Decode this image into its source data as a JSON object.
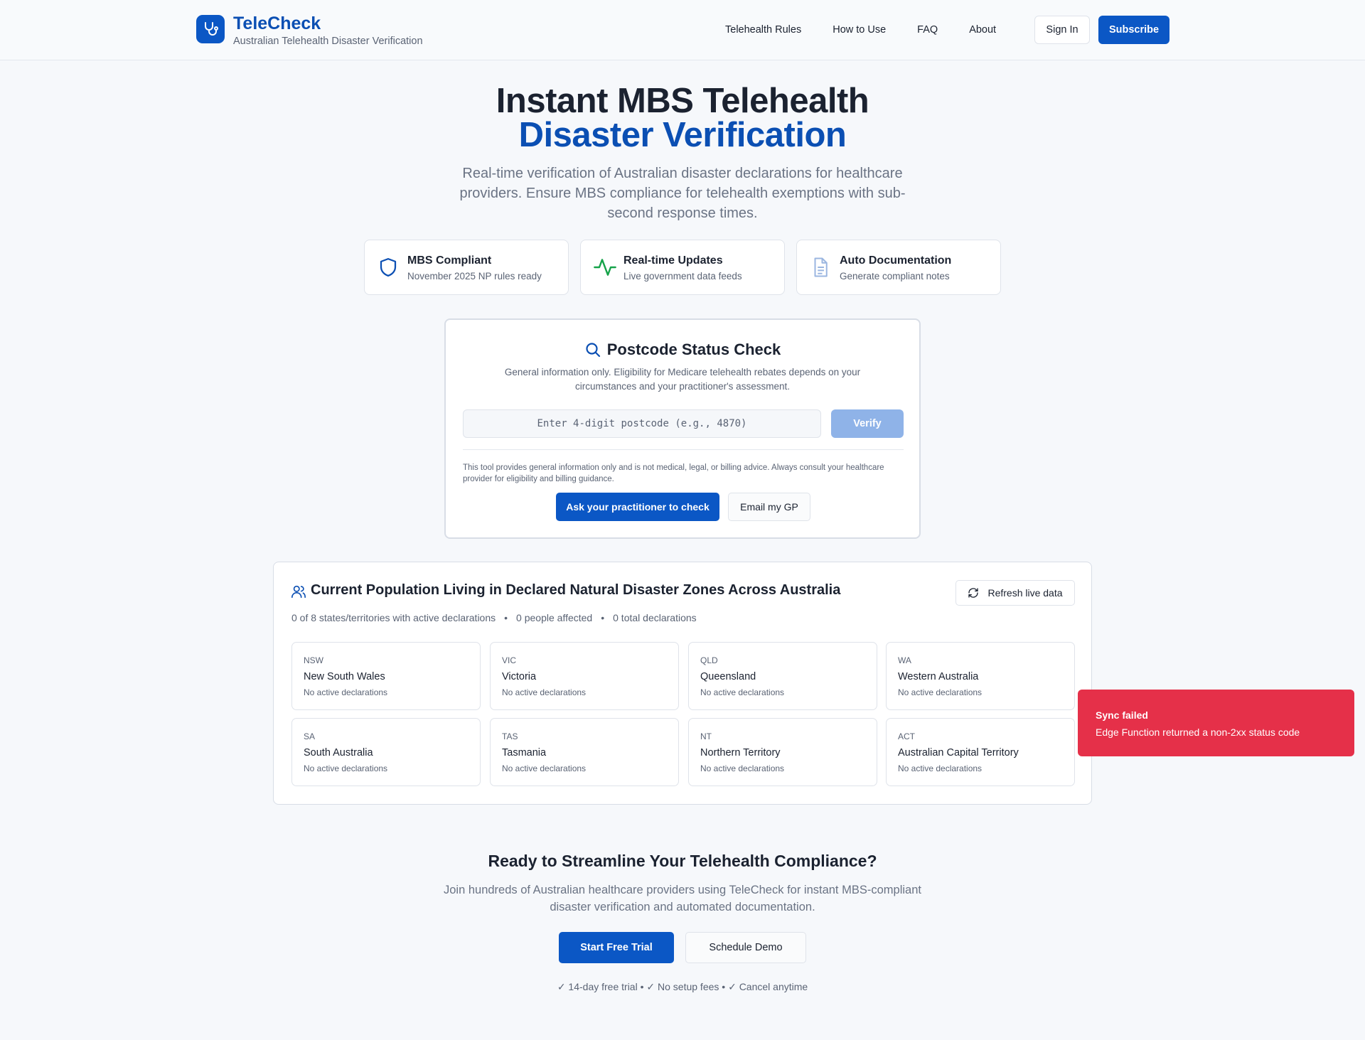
{
  "header": {
    "brand_name": "TeleCheck",
    "brand_tagline": "Australian Telehealth Disaster Verification",
    "nav": [
      "Telehealth Rules",
      "How to Use",
      "FAQ",
      "About"
    ],
    "sign_in": "Sign In",
    "subscribe": "Subscribe"
  },
  "hero": {
    "title_line1": "Instant MBS Telehealth",
    "title_line2": "Disaster Verification",
    "subtitle": "Real-time verification of Australian disaster declarations for healthcare providers. Ensure MBS compliance for telehealth exemptions with sub-second response times."
  },
  "features": [
    {
      "icon": "shield-icon",
      "title": "MBS Compliant",
      "subtitle": "November 2025 NP rules ready"
    },
    {
      "icon": "activity-icon",
      "title": "Real-time Updates",
      "subtitle": "Live government data feeds"
    },
    {
      "icon": "document-icon",
      "title": "Auto Documentation",
      "subtitle": "Generate compliant notes"
    }
  ],
  "postcode": {
    "title": "Postcode Status Check",
    "description": "General information only. Eligibility for Medicare telehealth rebates depends on your circumstances and your practitioner's assessment.",
    "input_placeholder": "Enter 4-digit postcode (e.g., 4870)",
    "input_value": "",
    "verify_label": "Verify",
    "disclaimer": "This tool provides general information only and is not medical, legal, or billing advice. Always consult your healthcare provider for eligibility and billing guidance.",
    "ask_label": "Ask your practitioner to check",
    "email_label": "Email my GP"
  },
  "population": {
    "title": "Current Population Living in Declared Natural Disaster Zones Across Australia",
    "refresh_label": "Refresh live data",
    "stats": [
      "0 of 8 states/territories with active declarations",
      "0 people affected",
      "0 total declarations"
    ],
    "states": [
      {
        "code": "NSW",
        "name": "New South Wales",
        "status": "No active declarations"
      },
      {
        "code": "VIC",
        "name": "Victoria",
        "status": "No active declarations"
      },
      {
        "code": "QLD",
        "name": "Queensland",
        "status": "No active declarations"
      },
      {
        "code": "WA",
        "name": "Western Australia",
        "status": "No active declarations"
      },
      {
        "code": "SA",
        "name": "South Australia",
        "status": "No active declarations"
      },
      {
        "code": "TAS",
        "name": "Tasmania",
        "status": "No active declarations"
      },
      {
        "code": "NT",
        "name": "Northern Territory",
        "status": "No active declarations"
      },
      {
        "code": "ACT",
        "name": "Australian Capital Territory",
        "status": "No active declarations"
      }
    ]
  },
  "toast": {
    "title": "Sync failed",
    "message": "Edge Function returned a non-2xx status code",
    "color": "#e53049"
  },
  "cta": {
    "title": "Ready to Streamline Your Telehealth Compliance?",
    "subtitle": "Join hundreds of Australian healthcare providers using TeleCheck for instant MBS-compliant disaster verification and automated documentation.",
    "trial_label": "Start Free Trial",
    "demo_label": "Schedule Demo",
    "note": "✓ 14-day free trial • ✓ No setup fees • ✓ Cancel anytime"
  },
  "colors": {
    "accent": "#0b57c5",
    "brand_text": "#0b4fb3",
    "success": "#16a34a"
  }
}
